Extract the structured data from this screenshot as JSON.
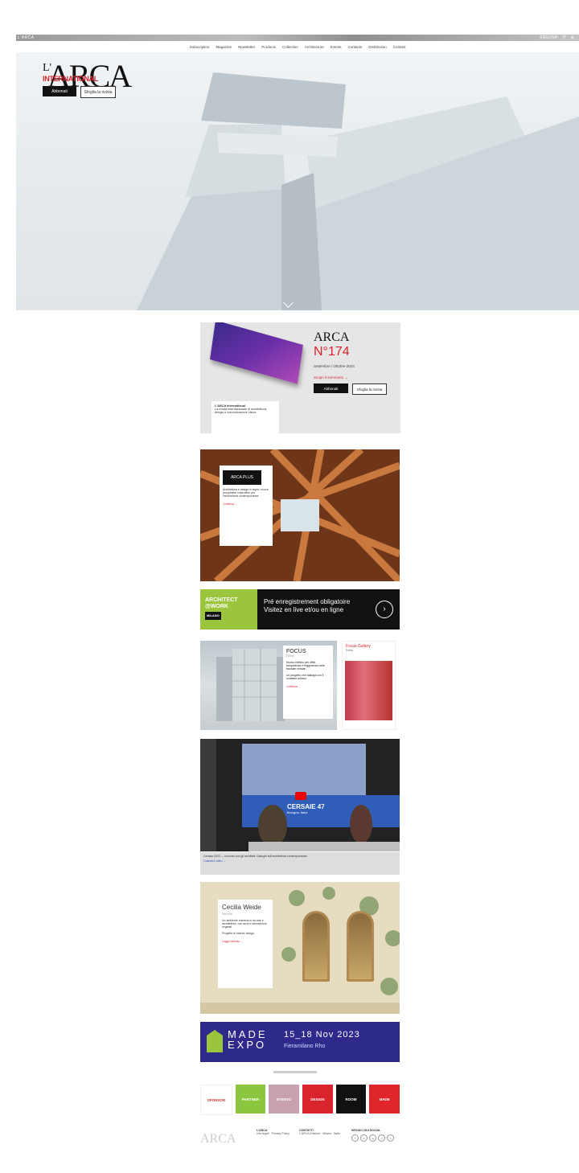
{
  "topbar": {
    "brand": "L'ARCA",
    "right": [
      "ENGLISH",
      "IT",
      "⊕"
    ]
  },
  "nav": [
    "Subscription",
    "Magazine",
    "Newsletter",
    "Products",
    "Collection",
    "Architecture",
    "Events",
    "Contacts",
    "Distribution",
    "Contact"
  ],
  "hero": {
    "logo_apos": "L'",
    "logo_main": "ARCA",
    "logo_sub": "INTERNATIONAL",
    "btn_primary": "Abbonati",
    "btn_secondary": "Sfoglia la rivista"
  },
  "issue": {
    "brand": "ARCA",
    "number": "N°174",
    "subtitle": "Settembre / Ottobre 2023",
    "link": "Scopri il sommario →",
    "btn_primary": "Abbonati",
    "btn_secondary": "Sfoglia la rivista",
    "card_title": "L'ARCA International",
    "card_text": "La rivista internazionale di architettura, design e comunicazione visiva"
  },
  "wood": {
    "tag": "ARCA PLUS",
    "text": "Architettura e design in legno: nuove prospettive costruttive per l'architettura contemporanea.",
    "link": "Continua →"
  },
  "banner1": {
    "left": "ARCHITECT @WORK",
    "left_sub": "MILANO",
    "line1": "Pré enregistrement obligatoire",
    "line2": "Visitez en live et/ou en ligne",
    "arrow": "›"
  },
  "focus": {
    "title": "FOCUS",
    "sub": "Edifici",
    "text": "Nuovo edificio per uffici: trasparenza e leggerezza nelle facciate vetrate.",
    "text2": "Un progetto che dialoga con il contesto urbano.",
    "link": "Continua →"
  },
  "side": {
    "title": "Focus Gallery",
    "sub": "Edifici"
  },
  "video": {
    "caption": "CERSAIE 47",
    "caption_sub": "Bologna, Italia",
    "text": "Cersaie 2023 — Incontro con gli architetti: Dialoghi sull'architettura contemporanea.",
    "link": "Guarda il video →"
  },
  "wall": {
    "title": "Cecilia Weide",
    "sub": "Interiors",
    "text": "Un ambiente immersivo tra arte e architettura, con archi e decorazioni vegetali.",
    "text2": "Progetto di interior design.",
    "link": "Leggi l'articolo →"
  },
  "made": {
    "name1": "MADE",
    "name2": "EXPO",
    "date": "15_18 Nov 2023",
    "place": "Fieramilano Rho"
  },
  "sponsors": [
    "SPONSOR",
    "PARTNER",
    "EVENTO",
    "DESIGN",
    "ROOM",
    "MADE"
  ],
  "footer": {
    "logo": "ARCA",
    "c1_title": "L'ARCA",
    "c1_text": "Info legali · Privacy Policy",
    "c2_title": "CONTATTI",
    "c2_text": "L'ARCA Edizioni · Milano · Italia",
    "c3_title": "SEGUICI SUI SOCIAL",
    "social": [
      "f",
      "in",
      "ig",
      "yt",
      "x"
    ]
  }
}
